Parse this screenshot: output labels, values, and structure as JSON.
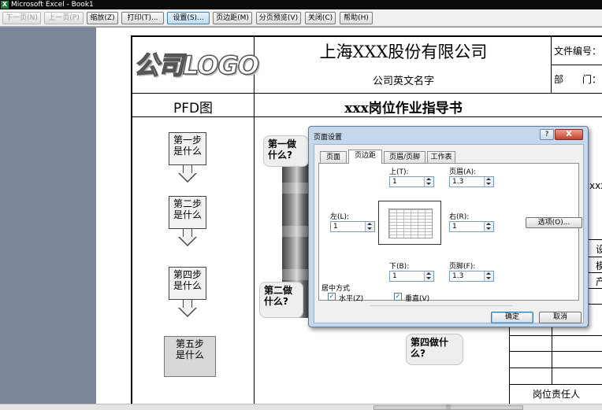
{
  "window": {
    "title": "Microsoft Excel - Book1",
    "app_icon": "X"
  },
  "toolbar": {
    "prev": "下一页(N)",
    "next": "上一页(P)",
    "zoom": "缩放(Z)",
    "print": "打印(T)...",
    "setup": "设置(S)...",
    "margins": "页边距(M)",
    "page_break": "分页预览(V)",
    "close": "关闭(C)",
    "help": "帮助(H)"
  },
  "sheet": {
    "logo": "公司LOGO",
    "company_name": "上海XXX股份有限公司",
    "company_en": "公司英文名字",
    "doc_no_label": "文件编号：",
    "dept_label": "部　　门：",
    "pfd_title": "PFD图",
    "guide_title": "xxx岗位作业指导书",
    "steps": [
      {
        "line1": "第一步",
        "line2": "是什么"
      },
      {
        "line1": "第二步",
        "line2": "是什么"
      },
      {
        "line1": "第四步",
        "line2": "是什么"
      },
      {
        "line1": "第五步",
        "line2": "是什么"
      }
    ],
    "bubble1": "第一做什么?",
    "bubble2": "第二做什么?",
    "bubble4": "第四做什么?",
    "right_xxx": "xxx",
    "right_col_1": "设",
    "right_col_2": "模",
    "right_col_3": "产",
    "footer_label": "岗位责任人"
  },
  "dialog": {
    "title": "页面设置",
    "help_button": "?",
    "close_button": "X",
    "tabs": [
      "页面",
      "页边距",
      "页眉/页脚",
      "工作表"
    ],
    "active_tab": "页边距",
    "top_label": "上(T):",
    "top_value": "1",
    "header_label": "页眉(A):",
    "header_value": "1.3",
    "left_label": "左(L):",
    "left_value": "1",
    "right_label": "右(R):",
    "right_value": "1",
    "bottom_label": "下(B):",
    "bottom_value": "1",
    "footer_label": "页脚(F):",
    "footer_value": "1.3",
    "options_button": "选项(O)...",
    "center_section": "居中方式",
    "horizontal": "水平(Z)",
    "vertical": "垂直(V)",
    "horizontal_checked": true,
    "vertical_checked": true,
    "ok_button": "确定",
    "cancel_button": "取消"
  }
}
